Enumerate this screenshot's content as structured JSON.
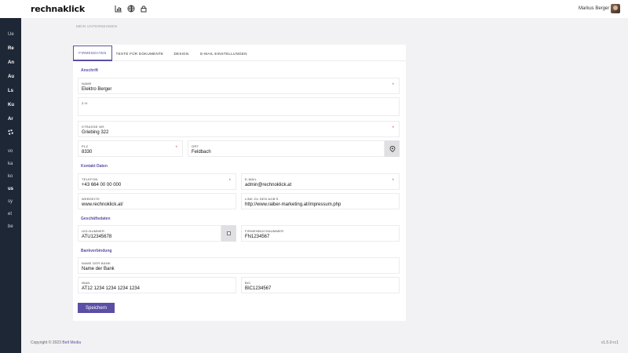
{
  "app": {
    "logo": "rechnaklick"
  },
  "topbar": {
    "icons": [
      "chart-icon",
      "globe-icon",
      "lock-icon"
    ],
    "user_name": "Markus Berger"
  },
  "sidebar": {
    "items_top": [
      "Ue",
      "Re",
      "An",
      "Au",
      "Ls",
      "Ku",
      "Ar"
    ],
    "items_bottom": [
      "vo",
      "ka",
      "ko",
      "us",
      "sy",
      "et",
      "be"
    ],
    "gear_icon": "gear-icon"
  },
  "breadcrumb": "MEIN UNTERNEHMEN",
  "tabs": [
    {
      "label": "FIRMENDATEN",
      "active": true
    },
    {
      "label": "TEXTE FÜR DOKUMENTE",
      "active": false
    },
    {
      "label": "DESIGN",
      "active": false
    },
    {
      "label": "E-MAIL EINSTELLUNGEN",
      "active": false
    }
  ],
  "sections": {
    "anschrift": "Anschrift",
    "kontakt": "Kontakt Daten",
    "geschaeft": "Geschäftsdaten",
    "bank": "Bankverbindung"
  },
  "fields": {
    "name": {
      "label": "NAME",
      "value": "Elektro Berger",
      "required_mark": "*"
    },
    "zh": {
      "label": "Z.H.",
      "value": ""
    },
    "strasse": {
      "label": "STRASSE NR.",
      "value": "Griebing 322",
      "required_mark": "*"
    },
    "plz": {
      "label": "PLZ",
      "value": "8330",
      "required_mark": "*"
    },
    "ort": {
      "label": "ORT",
      "value": "Feldbach"
    },
    "telefon": {
      "label": "TELEFON",
      "value": "+43 664 00 00 000",
      "required_mark": "*"
    },
    "email": {
      "label": "E-MAIL",
      "value": "admin@rechnoklick.at",
      "required_mark": "*"
    },
    "webseite": {
      "label": "WEBSEITE",
      "value": "www.rechnoklick.at/"
    },
    "agb": {
      "label": "LINK ZU DEN AGB'S",
      "value": "http://www.raiber-marketing.at/impressum.php"
    },
    "uid": {
      "label": "UID-NUMMER",
      "value": "ATU12345678"
    },
    "firmenbuch": {
      "label": "FIRMENBUCHNUMMER",
      "value": "FN1234567"
    },
    "bankname": {
      "label": "NAME DER BANK",
      "value": "Name der Bank"
    },
    "iban": {
      "label": "IBAN",
      "value": "AT12 1234 1234 1234 1234"
    },
    "bic": {
      "label": "BIC",
      "value": "BIC1234567"
    }
  },
  "buttons": {
    "save": "Speichern",
    "location_icon": "location-pin-icon"
  },
  "footer": {
    "copyright_prefix": "Copyright © 2023",
    "copyright_link": "Belt Media",
    "version": "v1.5.0-rc1"
  },
  "colors": {
    "accent": "#5a4fa5",
    "sidebar": "#1e2735",
    "required": "#e04848"
  }
}
